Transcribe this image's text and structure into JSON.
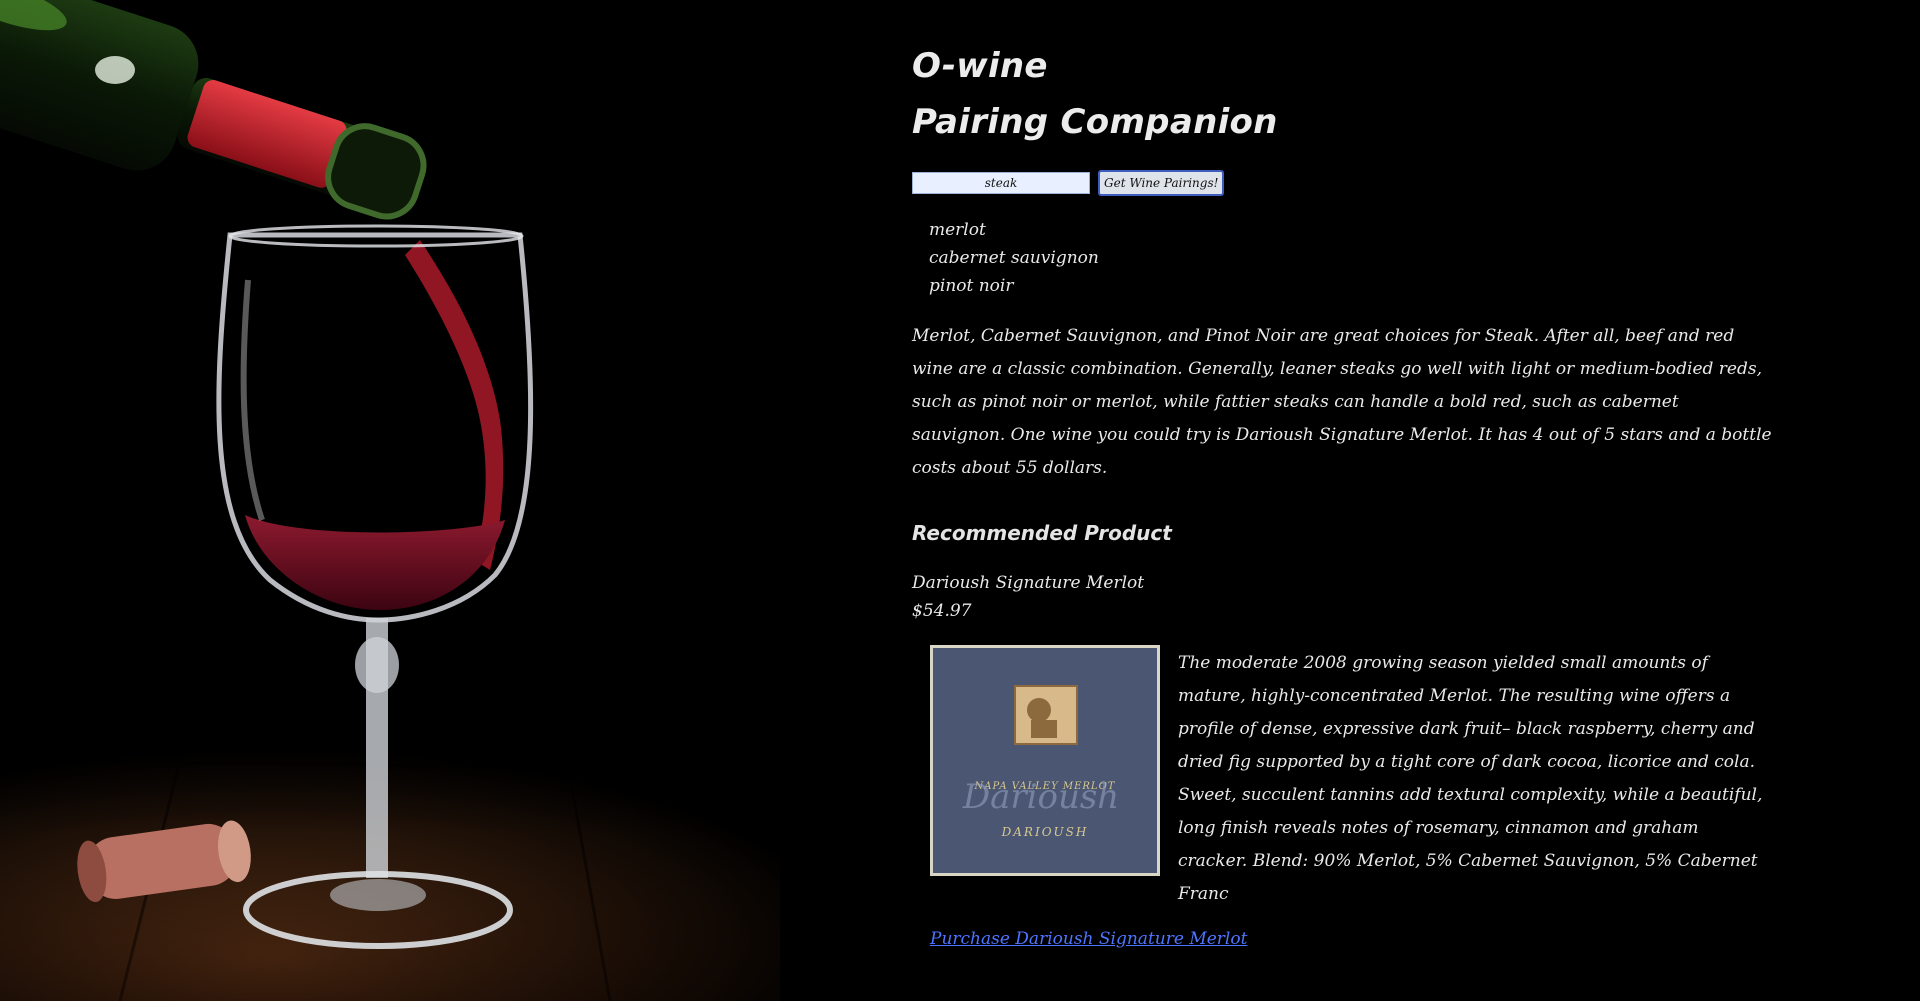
{
  "app": {
    "title_line1": "O-wine",
    "title_line2": "Pairing Companion"
  },
  "search": {
    "value": "steak",
    "button_label": "Get Wine Pairings!"
  },
  "pairings": [
    "merlot",
    "cabernet sauvignon",
    "pinot noir"
  ],
  "summary": "Merlot, Cabernet Sauvignon, and Pinot Noir are great choices for Steak. After all, beef and red wine are a classic combination. Generally, leaner steaks go well with light or medium-bodied reds, such as pinot noir or merlot, while fattier steaks can handle a bold red, such as cabernet sauvignon. One wine you could try is Darioush Signature Merlot. It has 4 out of 5 stars and a bottle costs about 55 dollars.",
  "recommended": {
    "heading": "Recommended Product",
    "name": "Darioush Signature Merlot",
    "price": "$54.97",
    "description": "The moderate 2008 growing season yielded small amounts of mature, highly-concentrated Merlot. The resulting wine offers a profile of dense, expressive dark fruit– black raspberry, cherry and dried fig supported by a tight core of dark cocoa, licorice and cola. Sweet, succulent tannins add textural complexity, while a beautiful, long finish reveals notes of rosemary, cinnamon and graham cracker. Blend: 90% Merlot, 5% Cabernet Sauvignon, 5% Cabernet Franc",
    "label_text": {
      "region": "NAPA VALLEY MERLOT",
      "brand": "DARIOUSH",
      "script": "Darioush"
    },
    "purchase_link": "Purchase Darioush Signature Merlot"
  },
  "colors": {
    "background": "#000000",
    "text": "#e9e9e9",
    "link": "#4f74ff",
    "input_bg": "#e8efff",
    "label_bg": "#4a5672"
  }
}
